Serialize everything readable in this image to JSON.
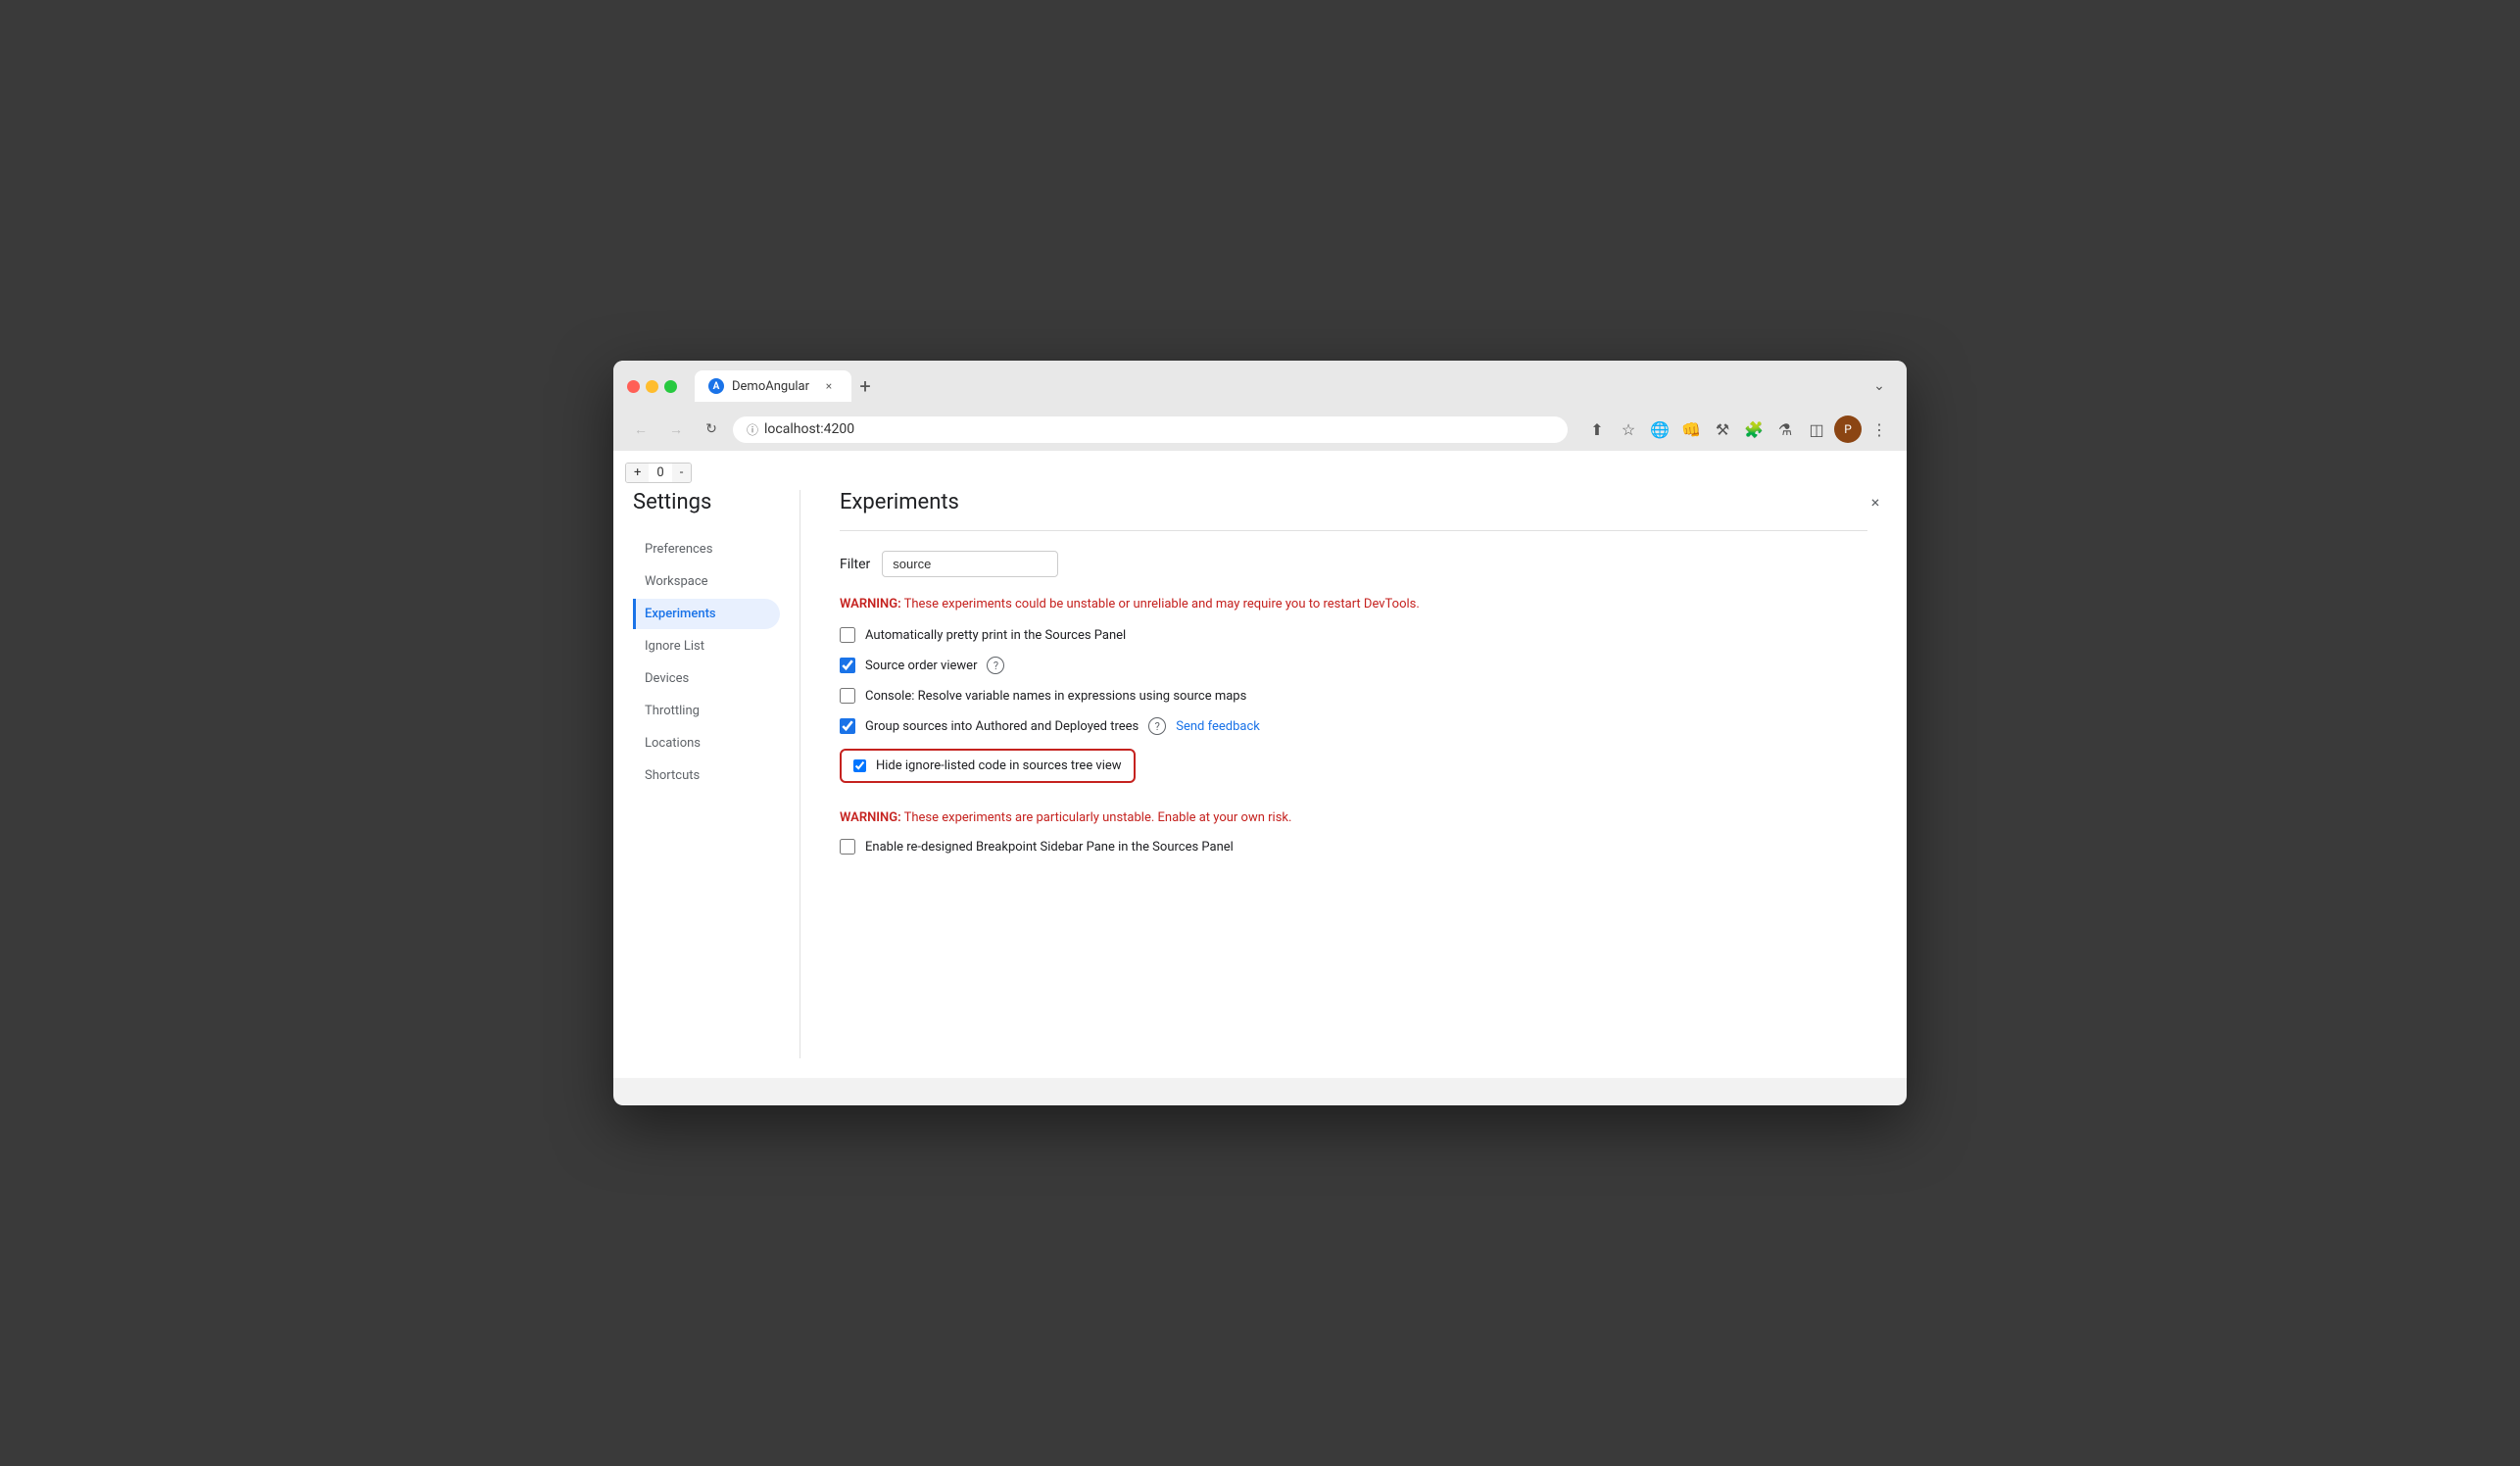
{
  "browser": {
    "tab_title": "DemoAngular",
    "tab_close": "×",
    "new_tab": "+",
    "address": "localhost:4200",
    "dropdown_arrow": "⌄"
  },
  "devtools_counter": {
    "plus": "+",
    "value": "0",
    "minus": "-"
  },
  "settings": {
    "title": "Settings",
    "sidebar_items": [
      {
        "id": "preferences",
        "label": "Preferences"
      },
      {
        "id": "workspace",
        "label": "Workspace"
      },
      {
        "id": "experiments",
        "label": "Experiments"
      },
      {
        "id": "ignore-list",
        "label": "Ignore List"
      },
      {
        "id": "devices",
        "label": "Devices"
      },
      {
        "id": "throttling",
        "label": "Throttling"
      },
      {
        "id": "locations",
        "label": "Locations"
      },
      {
        "id": "shortcuts",
        "label": "Shortcuts"
      }
    ]
  },
  "experiments": {
    "title": "Experiments",
    "filter_label": "Filter",
    "filter_value": "source",
    "filter_placeholder": "Filter",
    "warning1": "WARNING:",
    "warning1_text": " These experiments could be unstable or unreliable and may require you to restart DevTools.",
    "options": [
      {
        "id": "auto-pretty-print",
        "label": "Automatically pretty print in the Sources Panel",
        "checked": false,
        "has_help": false,
        "has_link": false,
        "highlighted": false
      },
      {
        "id": "source-order-viewer",
        "label": "Source order viewer",
        "checked": true,
        "has_help": true,
        "has_link": false,
        "highlighted": false
      },
      {
        "id": "console-resolve",
        "label": "Console: Resolve variable names in expressions using source maps",
        "checked": false,
        "has_help": false,
        "has_link": false,
        "highlighted": false
      },
      {
        "id": "group-sources",
        "label": "Group sources into Authored and Deployed trees",
        "checked": true,
        "has_help": true,
        "has_link": true,
        "link_text": "Send feedback",
        "highlighted": false
      },
      {
        "id": "hide-ignore-listed",
        "label": "Hide ignore-listed code in sources tree view",
        "checked": true,
        "has_help": false,
        "has_link": false,
        "highlighted": true
      }
    ],
    "warning2": "WARNING:",
    "warning2_text": " These experiments are particularly unstable. Enable at your own risk.",
    "unstable_options": [
      {
        "id": "redesigned-breakpoint",
        "label": "Enable re-designed Breakpoint Sidebar Pane in the Sources Panel",
        "checked": false
      }
    ],
    "close_btn": "×"
  }
}
